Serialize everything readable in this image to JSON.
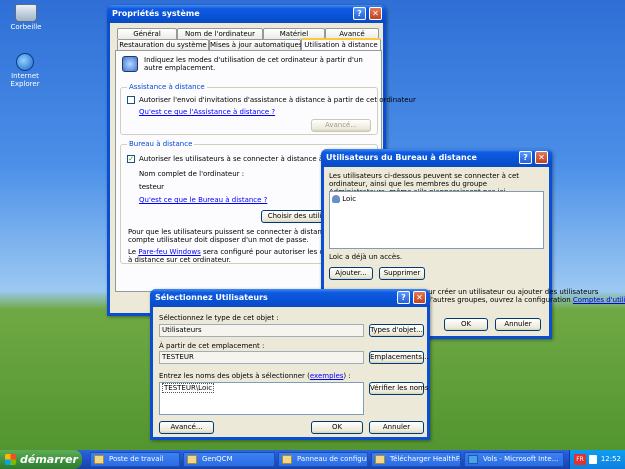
{
  "desktop": {
    "icons": [
      {
        "label": "Corbeille",
        "icon": "recycle-bin-icon"
      },
      {
        "label": "Internet Explorer",
        "icon": "internet-explorer-icon"
      }
    ]
  },
  "sysprops": {
    "title": "Propriétés système",
    "tabs_row1": [
      "Général",
      "Nom de l'ordinateur",
      "Matériel",
      "Avancé"
    ],
    "tabs_row2": [
      "Restauration du système",
      "Mises à jour automatiques",
      "Utilisation à distance"
    ],
    "intro": "Indiquez les modes d'utilisation de cet ordinateur à partir d'un autre emplacement.",
    "assist": {
      "label": "Assistance à distance",
      "checkbox": "Autoriser l'envoi d'invitations d'assistance à distance à partir de cet ordinateur",
      "link": "Qu'est ce que l'Assistance à distance ?",
      "advanced_button": "Avancé..."
    },
    "remote": {
      "label": "Bureau à distance",
      "checkbox": "Autoriser les utilisateurs à se connecter à distance à cet ordinateur",
      "fullname_label": "Nom complet de l'ordinateur :",
      "fullname_value": "testeur",
      "link": "Qu'est ce que le Bureau à distance ?",
      "choose_button": "Choisir des utilisateurs..."
    },
    "note1_line1": "Pour que les utilisateurs puissent se connecter à distance sur cet ordinateur, le",
    "note1_line2": "compte utilisateur doit disposer d'un mot de passe.",
    "note2_pre": "Le ",
    "note2_link": "Pare-feu Windows",
    "note2_post": " sera configuré pour autoriser les connexions",
    "note2_line2": "à distance sur cet ordinateur."
  },
  "rdusers": {
    "title": "Utilisateurs du Bureau à distance",
    "intro": "Les utilisateurs ci-dessous peuvent se connecter à cet ordinateur, ainsi que les membres du groupe Administrateurs, même s'ils n'apparaissent pas ici.",
    "list": [
      "Loic"
    ],
    "status": "Loic a déjà un accès.",
    "add_button": "Ajouter...",
    "remove_button": "Supprimer",
    "hint_line1": "Pour créer un utilisateur ou ajouter des utilisateurs",
    "hint_pre": "à d'autres groupes, ouvrez la configuration ",
    "hint_link": "Comptes d'utilisateurs",
    "hint_post": ".",
    "ok": "OK",
    "cancel": "Annuler"
  },
  "selusers": {
    "title": "Sélectionnez Utilisateurs",
    "type_label": "Sélectionnez le type de cet objet :",
    "type_value": "Utilisateurs",
    "type_button": "Types d'objet...",
    "loc_label": "À partir de cet emplacement :",
    "loc_value": "TESTEUR",
    "loc_button": "Emplacements...",
    "names_label_pre": "Entrez les noms des objets à sélectionner (",
    "names_label_link": "exemples",
    "names_label_post": ") :",
    "names_value": "TESTEUR\\Loic",
    "check_button": "Vérifier les noms",
    "advanced_button": "Avancé...",
    "ok": "OK",
    "cancel": "Annuler"
  },
  "taskbar": {
    "start": "démarrer",
    "tasks": [
      "Poste de travail",
      "GenQCM",
      "Panneau de configur...",
      "Télécharger HealthF...",
      "Vols - Microsoft Inte..."
    ],
    "lang": "FR",
    "clock": "12:52"
  },
  "colors": {
    "titlebar": "#0853d6",
    "taskbar": "#245edb",
    "start": "#3c8f3b",
    "link": "#0000ff"
  }
}
